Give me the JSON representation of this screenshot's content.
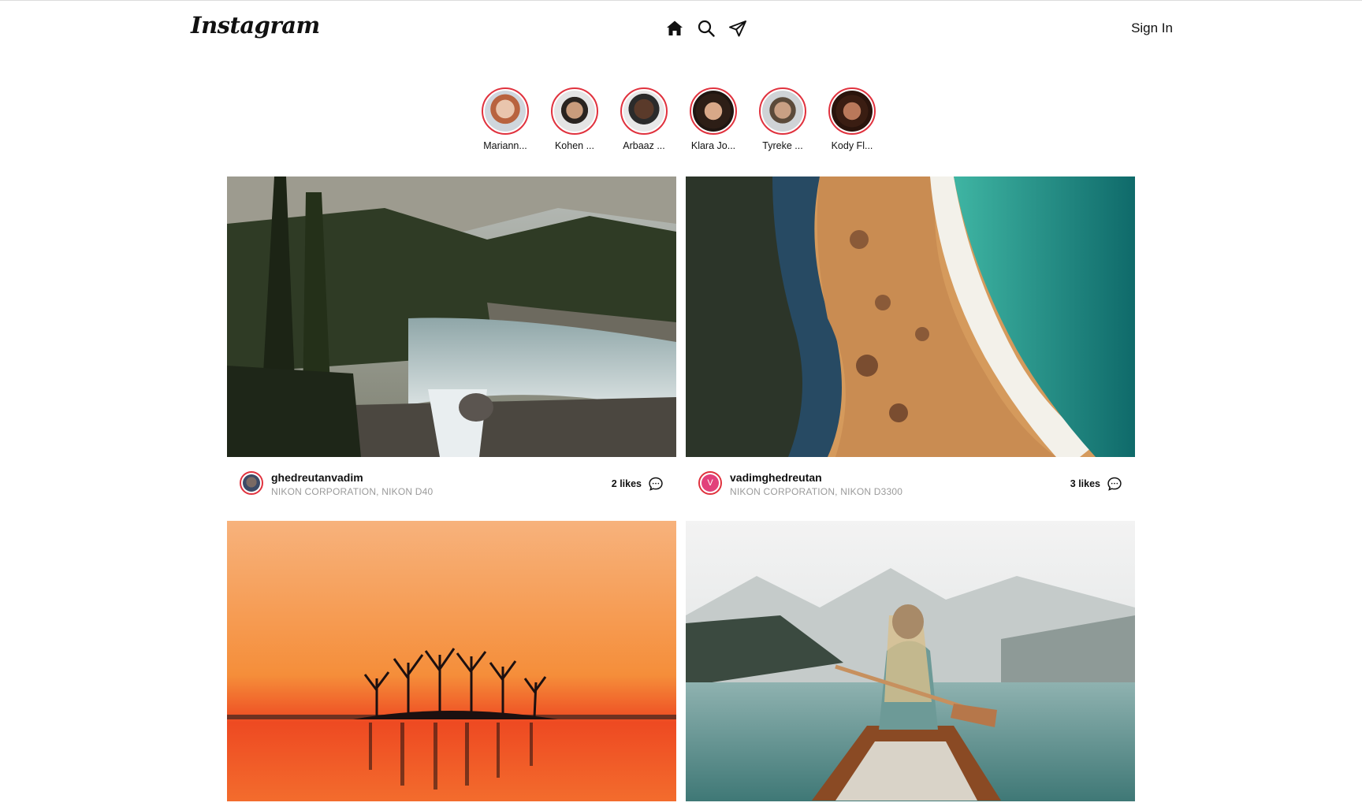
{
  "header": {
    "logo": "Instagram",
    "nav": [
      {
        "icon": "home-icon"
      },
      {
        "icon": "search-icon"
      },
      {
        "icon": "send-icon"
      }
    ],
    "sign_in": "Sign In"
  },
  "stories": [
    {
      "name": "Mariann..."
    },
    {
      "name": "Kohen ..."
    },
    {
      "name": "Arbaaz ..."
    },
    {
      "name": "Klara Jo..."
    },
    {
      "name": "Tyreke ..."
    },
    {
      "name": "Kody Fl..."
    }
  ],
  "posts": [
    {
      "username": "ghedreutanvadim",
      "camera": "NIKON CORPORATION, NIKON D40",
      "likes": "2 likes",
      "photo": "forest-river-waterfall"
    },
    {
      "username": "vadimghedreutan",
      "camera": "NIKON CORPORATION, NIKON D3300",
      "likes": "3 likes",
      "avatar_letter": "V",
      "photo": "aerial-beach-coast"
    },
    {
      "photo": "sunset-lake-island"
    },
    {
      "photo": "woman-canoe-lake"
    }
  ],
  "colors": {
    "story_ring": "#e0323e",
    "avatar_pink": "#e2407a",
    "secondary_text": "#9a9a9a"
  }
}
